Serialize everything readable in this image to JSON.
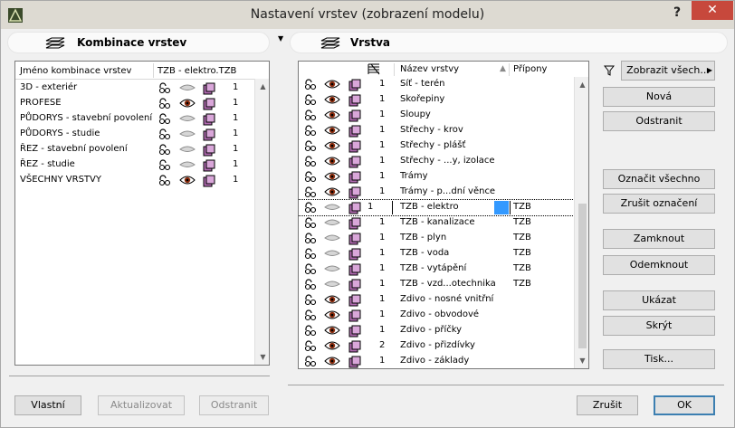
{
  "window": {
    "title": "Nastavení vrstev (zobrazení modelu)",
    "help_label": "?",
    "close_label": "✕"
  },
  "left_panel": {
    "title": "Kombinace vrstev",
    "col_name": "Jméno kombinace vrstev",
    "col_layer": "TZB - elektro.TZB",
    "rows": [
      {
        "name": "3D - exteriér",
        "visible": false,
        "num": "1"
      },
      {
        "name": "PROFESE",
        "visible": true,
        "num": "1"
      },
      {
        "name": "PŮDORYS - stavební povolení",
        "visible": false,
        "num": "1"
      },
      {
        "name": "PŮDORYS - studie",
        "visible": false,
        "num": "1"
      },
      {
        "name": "ŘEZ - stavební povolení",
        "visible": false,
        "num": "1"
      },
      {
        "name": "ŘEZ - studie",
        "visible": false,
        "num": "1"
      },
      {
        "name": "VŠECHNY VRSTVY",
        "visible": true,
        "num": "1"
      }
    ],
    "buttons": {
      "own": "Vlastní",
      "update": "Aktualizovat",
      "remove": "Odstranit"
    }
  },
  "right_panel": {
    "title": "Vrstva",
    "col_name": "Název vrstvy",
    "col_ext": "Přípony",
    "rows": [
      {
        "name": "Síť - terén",
        "visible": true,
        "num": "1",
        "ext": ""
      },
      {
        "name": "Skořepiny",
        "visible": true,
        "num": "1",
        "ext": ""
      },
      {
        "name": "Sloupy",
        "visible": true,
        "num": "1",
        "ext": ""
      },
      {
        "name": "Střechy - krov",
        "visible": true,
        "num": "1",
        "ext": ""
      },
      {
        "name": "Střechy - plášť",
        "visible": true,
        "num": "1",
        "ext": ""
      },
      {
        "name": "Střechy - ...y, izolace",
        "visible": true,
        "num": "1",
        "ext": ""
      },
      {
        "name": "Trámy",
        "visible": true,
        "num": "1",
        "ext": ""
      },
      {
        "name": "Trámy - p...dní věnce",
        "visible": true,
        "num": "1",
        "ext": ""
      },
      {
        "name": "TZB - elektro",
        "visible": false,
        "num": "1",
        "ext": "TZB",
        "selected": true
      },
      {
        "name": "TZB - kanalizace",
        "visible": false,
        "num": "1",
        "ext": "TZB"
      },
      {
        "name": "TZB - plyn",
        "visible": false,
        "num": "1",
        "ext": "TZB"
      },
      {
        "name": "TZB - voda",
        "visible": false,
        "num": "1",
        "ext": "TZB"
      },
      {
        "name": "TZB - vytápění",
        "visible": false,
        "num": "1",
        "ext": "TZB"
      },
      {
        "name": "TZB - vzd...otechnika",
        "visible": false,
        "num": "1",
        "ext": "TZB"
      },
      {
        "name": "Zdivo - nosné vnitřní",
        "visible": true,
        "num": "1",
        "ext": ""
      },
      {
        "name": "Zdivo - obvodové",
        "visible": true,
        "num": "1",
        "ext": ""
      },
      {
        "name": "Zdivo - příčky",
        "visible": true,
        "num": "1",
        "ext": ""
      },
      {
        "name": "Zdivo - přizdívky",
        "visible": true,
        "num": "2",
        "ext": ""
      },
      {
        "name": "Zdivo - základy",
        "visible": true,
        "num": "1",
        "ext": ""
      }
    ]
  },
  "side_buttons": {
    "filter": "Zobrazit všech...",
    "new": "Nová",
    "remove": "Odstranit",
    "select_all": "Označit všechno",
    "deselect": "Zrušit označení",
    "lock": "Zamknout",
    "unlock": "Odemknout",
    "show": "Ukázat",
    "hide": "Skrýt",
    "print": "Tisk..."
  },
  "footer": {
    "cancel": "Zrušit",
    "ok": "OK"
  },
  "colors": {
    "selection": "#3399ff",
    "close": "#c7483c",
    "eye_iris": "#8a2b0c",
    "layer_icon": "#b06ab0"
  }
}
